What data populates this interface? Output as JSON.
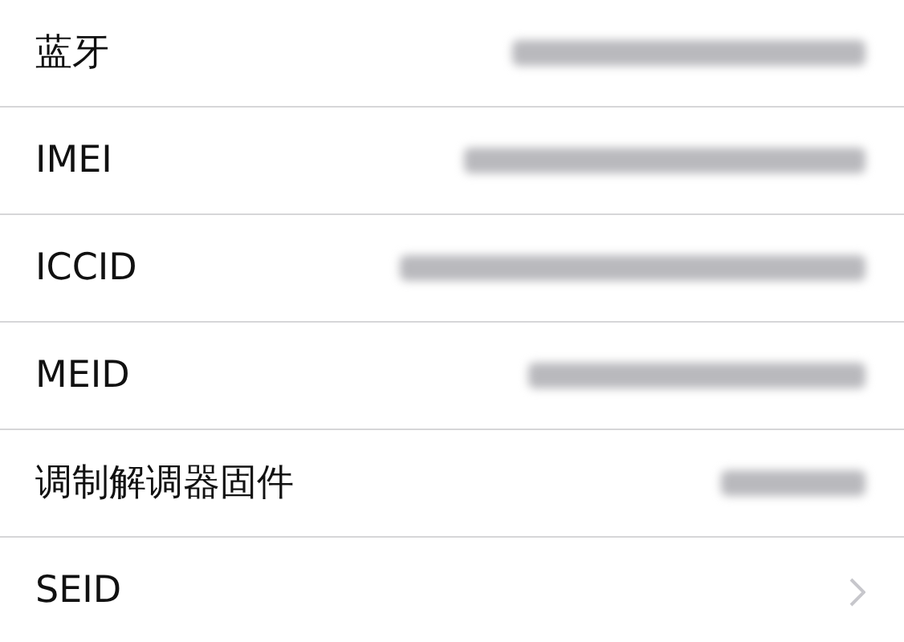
{
  "rows": [
    {
      "label": "蓝牙",
      "kind": "value"
    },
    {
      "label": "IMEI",
      "kind": "value"
    },
    {
      "label": "ICCID",
      "kind": "value"
    },
    {
      "label": "MEID",
      "kind": "value"
    },
    {
      "label": "调制解调器固件",
      "kind": "value"
    },
    {
      "label": "SEID",
      "kind": "disclosure"
    }
  ]
}
